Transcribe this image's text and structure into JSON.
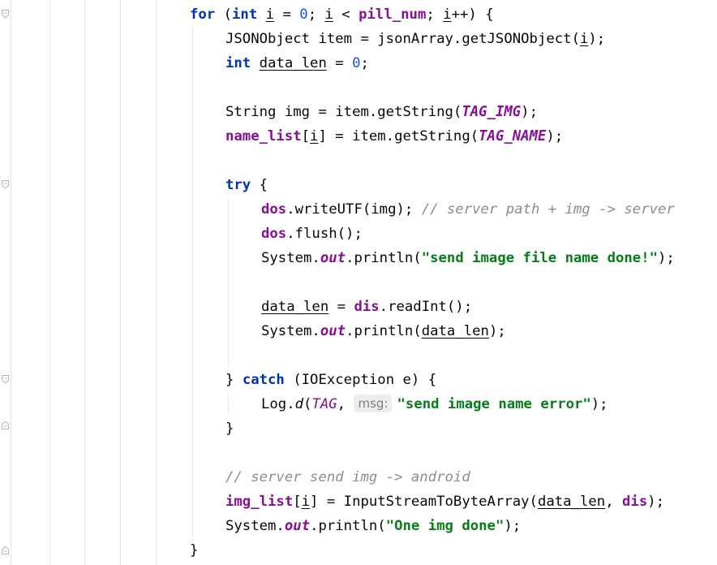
{
  "editor": {
    "lines": {
      "l1": {
        "kw_for": "for",
        "open": " (",
        "kw_int": "int",
        "var_i": "i",
        "eq": " = ",
        "zero": "0",
        "semi1": "; ",
        "i2": "i",
        "lt": " < ",
        "pill": "pill_num",
        "semi2": "; ",
        "i3": "i",
        "inc": "++) {"
      },
      "l2": {
        "text_a": "JSONObject item = jsonArray.getJSONObject(",
        "i": "i",
        "close": ");"
      },
      "l3": {
        "kw_int": "int",
        "sp": " ",
        "var": "data_len",
        "eq": " = ",
        "zero": "0",
        "semi": ";"
      },
      "l4": {
        "text_a": "String img = item.getString(",
        "const": "TAG_IMG",
        "close": ");"
      },
      "l5": {
        "field": "name_list",
        "br1": "[",
        "i": "i",
        "br2": "] = item.getString(",
        "const": "TAG_NAME",
        "close": ");"
      },
      "l6": {
        "kw": "try",
        "rest": " {"
      },
      "l7": {
        "field": "dos",
        "call": ".writeUTF(img); ",
        "comment": "// server path + img -> server"
      },
      "l8": {
        "field": "dos",
        "call": ".flush();"
      },
      "l9": {
        "sys": "System.",
        "out": "out",
        "call": ".println(",
        "str": "\"send image file name done!\"",
        "close": ");"
      },
      "l10": {
        "var": "data_len",
        "eq": " = ",
        "field": "dis",
        "call": ".readInt();"
      },
      "l11": {
        "sys": "System.",
        "out": "out",
        "call": ".println(",
        "var": "data_len",
        "close": ");"
      },
      "l12": {
        "brace": "} ",
        "kw": "catch",
        "rest": " (IOException e) {"
      },
      "l13": {
        "log": "Log.",
        "d": "d",
        "open": "(",
        "tag": "TAG",
        "comma": ", ",
        "hint": "msg:",
        "str": "\"send image name error\"",
        "close": ");"
      },
      "l14": {
        "brace": "}"
      },
      "l15": {
        "comment": "// server send img -> android"
      },
      "l16": {
        "field": "img_list",
        "br1": "[",
        "i": "i",
        "br2": "] = InputStreamToByteArray(",
        "var": "data_len",
        "comma": ", ",
        "field2": "dis",
        "close": ");"
      },
      "l17": {
        "sys": "System.",
        "out": "out",
        "call": ".println(",
        "str": "\"One img done\"",
        "close": ");"
      },
      "l18": {
        "brace": "}"
      }
    }
  }
}
